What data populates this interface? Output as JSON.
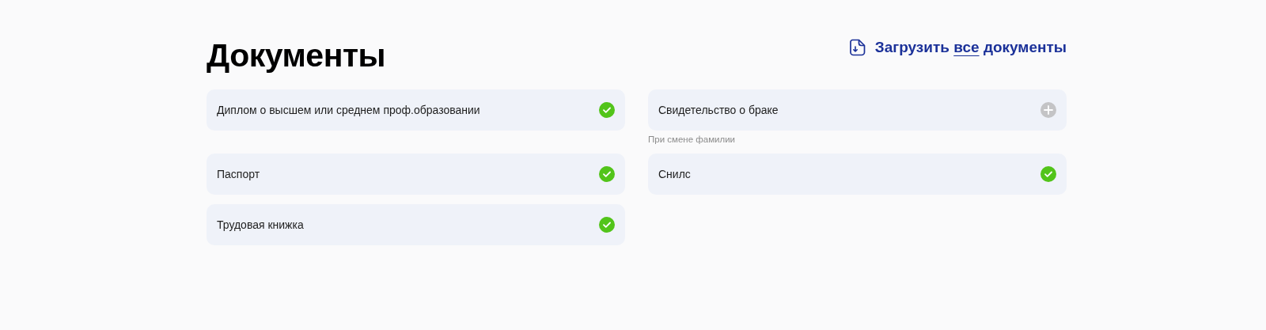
{
  "title": "Документы",
  "upload_all": {
    "before": "Загрузить",
    "underlined": "все",
    "after": "документы"
  },
  "documents": [
    {
      "name": "Диплом о высшем или среднем проф.образовании",
      "uploaded": true
    },
    {
      "name": "Свидетельство о браке",
      "uploaded": false,
      "hint": "При смене фамилии"
    },
    {
      "name": "Паспорт",
      "uploaded": true
    },
    {
      "name": "Снилс",
      "uploaded": true
    },
    {
      "name": "Трудовая книжка",
      "uploaded": true
    }
  ]
}
